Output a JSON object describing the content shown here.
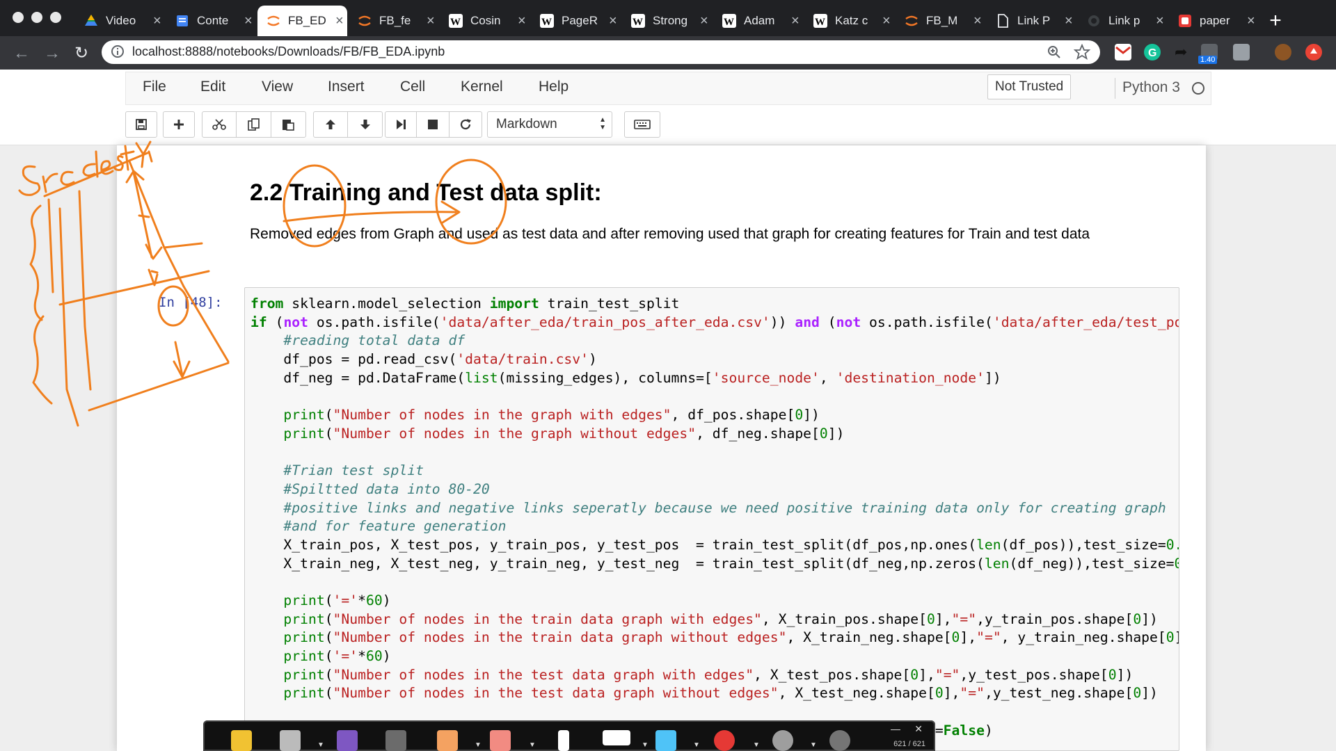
{
  "browser": {
    "tabs": [
      {
        "title": "Video",
        "icon": "google-drive-icon",
        "color": "#f4b400"
      },
      {
        "title": "Conte",
        "icon": "google-docs-icon",
        "color": "#4285f4"
      },
      {
        "title": "FB_ED",
        "icon": "jupyter-icon",
        "color": "#f37726",
        "active": true
      },
      {
        "title": "FB_fe",
        "icon": "jupyter-icon",
        "color": "#f37726"
      },
      {
        "title": "Cosin",
        "icon": "wikipedia-icon",
        "color": "#ffffff"
      },
      {
        "title": "PageR",
        "icon": "wikipedia-icon",
        "color": "#ffffff"
      },
      {
        "title": "Strong",
        "icon": "wikipedia-icon",
        "color": "#ffffff"
      },
      {
        "title": "Adam",
        "icon": "wikipedia-icon",
        "color": "#ffffff"
      },
      {
        "title": "Katz c",
        "icon": "wikipedia-icon",
        "color": "#ffffff"
      },
      {
        "title": "FB_M",
        "icon": "jupyter-icon",
        "color": "#f37726"
      },
      {
        "title": "Link P",
        "icon": "document-icon",
        "color": "#ffffff"
      },
      {
        "title": "Link p",
        "icon": "github-icon",
        "color": "#ffffff"
      },
      {
        "title": "paper",
        "icon": "pdf-icon",
        "color": "#e53935"
      }
    ],
    "url": "localhost:8888/notebooks/Downloads/FB/FB_EDA.ipynb",
    "extension_badge": "1.40"
  },
  "jupyter": {
    "menu": [
      "File",
      "Edit",
      "View",
      "Insert",
      "Cell",
      "Kernel",
      "Help"
    ],
    "trust_label": "Not Trusted",
    "kernel_name": "Python 3",
    "cell_type": "Markdown"
  },
  "notebook": {
    "heading": "2.2 Training and Test data split:",
    "paragraph": "Removed edges from Graph and used as test data and after removing used that graph for creating features for Train and test data",
    "prompt": "In [48]:"
  },
  "annotation": {
    "handwriting": "Src dest yi"
  },
  "pen_toolbar": {
    "counter": "621 / 621"
  }
}
